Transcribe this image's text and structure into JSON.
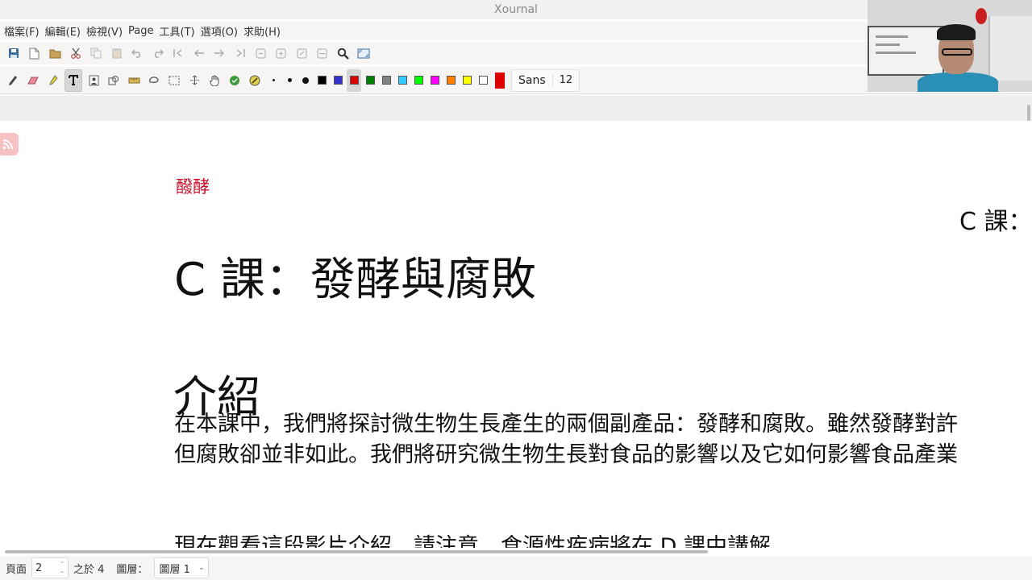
{
  "window": {
    "title": "Xournal"
  },
  "menu": [
    "檔案(F)",
    "編輯(E)",
    "檢視(V)",
    "Page",
    "工具(T)",
    "選項(O)",
    "求助(H)"
  ],
  "toolbar_icons": [
    "save-icon",
    "new-icon",
    "open-icon",
    "cut-icon",
    "copy-icon",
    "paste-icon",
    "undo-icon",
    "redo-icon",
    "first-page-icon",
    "previous-page-icon",
    "next-page-icon",
    "last-page-icon",
    "zoom-out-icon",
    "zoom-in-icon",
    "zoom-fit-icon",
    "page-width-icon",
    "search-icon",
    "fullscreen-icon"
  ],
  "tools": {
    "active_tool": "text",
    "colors": [
      {
        "name": "black",
        "hex": "#000000"
      },
      {
        "name": "blue",
        "hex": "#3333cc"
      },
      {
        "name": "red",
        "hex": "#dd0000"
      },
      {
        "name": "green",
        "hex": "#008000"
      },
      {
        "name": "gray",
        "hex": "#808080"
      },
      {
        "name": "light-blue",
        "hex": "#33ccff"
      },
      {
        "name": "light-green",
        "hex": "#00ff00"
      },
      {
        "name": "magenta",
        "hex": "#ff00ff"
      },
      {
        "name": "orange",
        "hex": "#ff8000"
      },
      {
        "name": "yellow",
        "hex": "#ffff00"
      },
      {
        "name": "white",
        "hex": "#ffffff"
      }
    ],
    "selected_color": "#dd0000",
    "font_name": "Sans",
    "font_size": "12"
  },
  "document": {
    "tag": "醱酵",
    "right_header": "C 課：",
    "lesson_title": "C 課：發酵與腐敗",
    "intro_heading": "介紹",
    "paragraph_line1": "在本課中，我們將探討微生物生長產生的兩個副產品：發酵和腐敗。雖然發酵對許",
    "paragraph_line2": "但腐敗卻並非如此。我們將研究微生物生長對食品的影響以及它如何影響食品產業",
    "paragraph_line3": "現在觀看這段影片介紹。請注意，食源性疾病將在 D 課中講解。"
  },
  "status": {
    "page_label": "頁面",
    "page_value": "2",
    "page_of": "之於 4",
    "layer_label": "圖層：",
    "layer_value": "圖層 1"
  }
}
